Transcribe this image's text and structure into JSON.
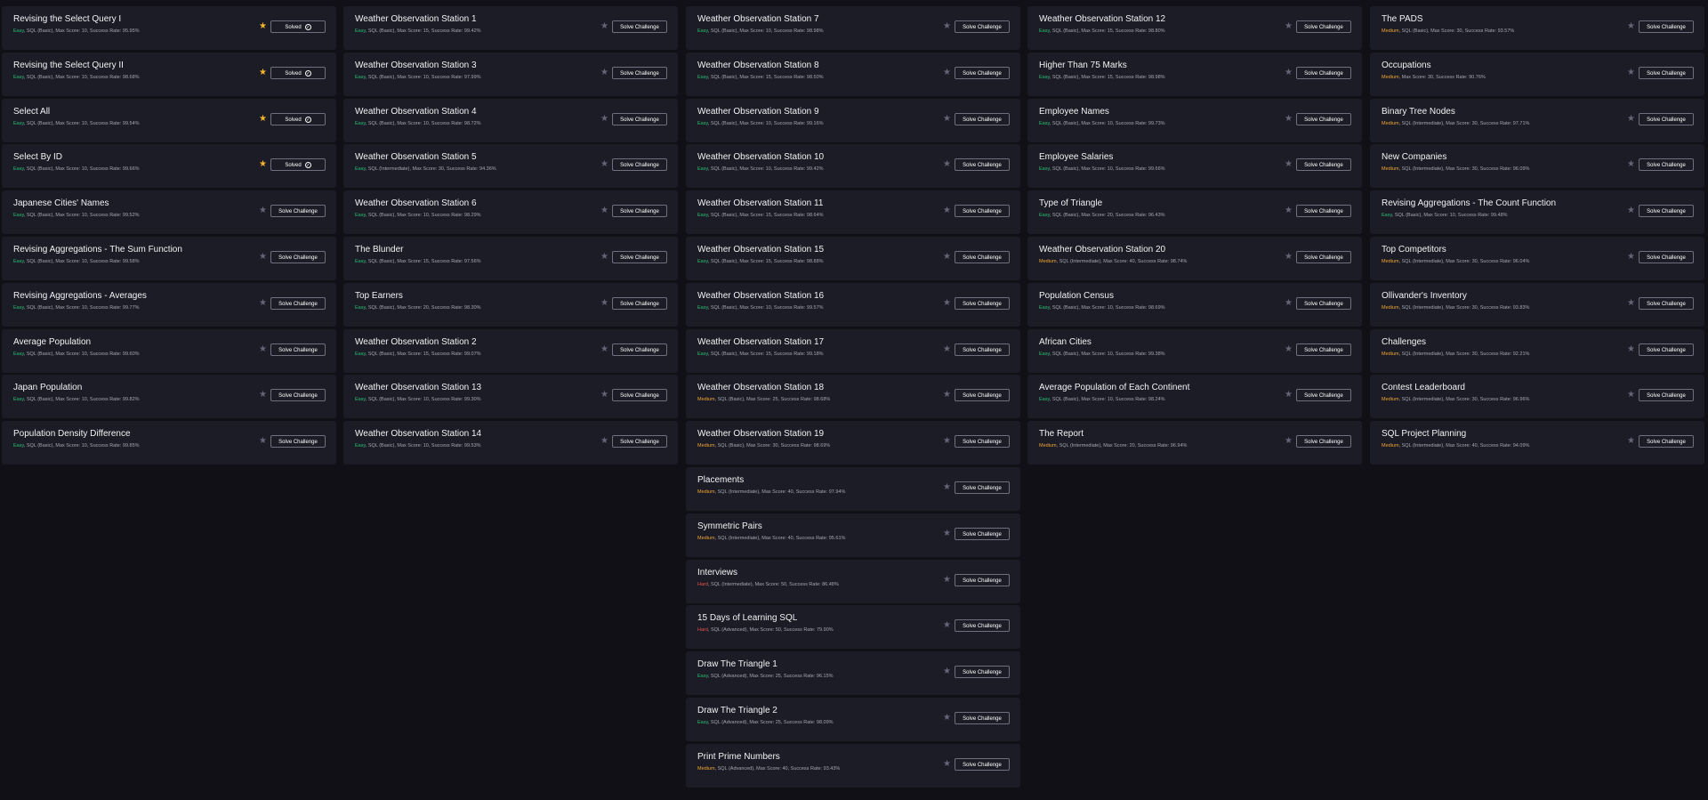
{
  "columns": [
    [
      {
        "title": "Revising the Select Query I",
        "difficulty": "Easy",
        "details": ", SQL (Basic), Max Score: 10, Success Rate: 95.95%",
        "starred": true,
        "button": "Solved",
        "solved": true
      },
      {
        "title": "Revising the Select Query II",
        "difficulty": "Easy",
        "details": ", SQL (Basic), Max Score: 10, Success Rate: 98.68%",
        "starred": true,
        "button": "Solved",
        "solved": true
      },
      {
        "title": "Select All",
        "difficulty": "Easy",
        "details": ", SQL (Basic), Max Score: 10, Success Rate: 99.54%",
        "starred": true,
        "button": "Solved",
        "solved": true
      },
      {
        "title": "Select By ID",
        "difficulty": "Easy",
        "details": ", SQL (Basic), Max Score: 10, Success Rate: 99.66%",
        "starred": true,
        "button": "Solved",
        "solved": true
      },
      {
        "title": "Japanese Cities' Names",
        "difficulty": "Easy",
        "details": ", SQL (Basic), Max Score: 10, Success Rate: 99.52%",
        "starred": false,
        "button": "Solve Challenge",
        "solved": false
      },
      {
        "title": "Revising Aggregations - The Sum Function",
        "difficulty": "Easy",
        "details": ", SQL (Basic), Max Score: 10, Success Rate: 99.58%",
        "starred": false,
        "button": "Solve Challenge",
        "solved": false
      },
      {
        "title": "Revising Aggregations - Averages",
        "difficulty": "Easy",
        "details": ", SQL (Basic), Max Score: 10, Success Rate: 99.77%",
        "starred": false,
        "button": "Solve Challenge",
        "solved": false
      },
      {
        "title": "Average Population",
        "difficulty": "Easy",
        "details": ", SQL (Basic), Max Score: 10, Success Rate: 99.60%",
        "starred": false,
        "button": "Solve Challenge",
        "solved": false
      },
      {
        "title": "Japan Population",
        "difficulty": "Easy",
        "details": ", SQL (Basic), Max Score: 10, Success Rate: 99.82%",
        "starred": false,
        "button": "Solve Challenge",
        "solved": false
      },
      {
        "title": "Population Density Difference",
        "difficulty": "Easy",
        "details": ", SQL (Basic), Max Score: 10, Success Rate: 99.85%",
        "starred": false,
        "button": "Solve Challenge",
        "solved": false
      }
    ],
    [
      {
        "title": "Weather Observation Station 1",
        "difficulty": "Easy",
        "details": ", SQL (Basic), Max Score: 15, Success Rate: 99.42%",
        "starred": false,
        "button": "Solve Challenge",
        "solved": false
      },
      {
        "title": "Weather Observation Station 3",
        "difficulty": "Easy",
        "details": ", SQL (Basic), Max Score: 10, Success Rate: 97.99%",
        "starred": false,
        "button": "Solve Challenge",
        "solved": false
      },
      {
        "title": "Weather Observation Station 4",
        "difficulty": "Easy",
        "details": ", SQL (Basic), Max Score: 10, Success Rate: 98.72%",
        "starred": false,
        "button": "Solve Challenge",
        "solved": false
      },
      {
        "title": "Weather Observation Station 5",
        "difficulty": "Easy",
        "details": ", SQL (Intermediate), Max Score: 30, Success Rate: 94.36%",
        "starred": false,
        "button": "Solve Challenge",
        "solved": false
      },
      {
        "title": "Weather Observation Station 6",
        "difficulty": "Easy",
        "details": ", SQL (Basic), Max Score: 10, Success Rate: 98.29%",
        "starred": false,
        "button": "Solve Challenge",
        "solved": false
      },
      {
        "title": "The Blunder",
        "difficulty": "Easy",
        "details": ", SQL (Basic), Max Score: 15, Success Rate: 97.56%",
        "starred": false,
        "button": "Solve Challenge",
        "solved": false
      },
      {
        "title": "Top Earners",
        "difficulty": "Easy",
        "details": ", SQL (Basic), Max Score: 20, Success Rate: 98.30%",
        "starred": false,
        "button": "Solve Challenge",
        "solved": false
      },
      {
        "title": "Weather Observation Station 2",
        "difficulty": "Easy",
        "details": ", SQL (Basic), Max Score: 15, Success Rate: 99.07%",
        "starred": false,
        "button": "Solve Challenge",
        "solved": false
      },
      {
        "title": "Weather Observation Station 13",
        "difficulty": "Easy",
        "details": ", SQL (Basic), Max Score: 10, Success Rate: 99.30%",
        "starred": false,
        "button": "Solve Challenge",
        "solved": false
      },
      {
        "title": "Weather Observation Station 14",
        "difficulty": "Easy",
        "details": ", SQL (Basic), Max Score: 10, Success Rate: 99.53%",
        "starred": false,
        "button": "Solve Challenge",
        "solved": false
      }
    ],
    [
      {
        "title": "Weather Observation Station 7",
        "difficulty": "Easy",
        "details": ", SQL (Basic), Max Score: 10, Success Rate: 98.98%",
        "starred": false,
        "button": "Solve Challenge",
        "solved": false
      },
      {
        "title": "Weather Observation Station 8",
        "difficulty": "Easy",
        "details": ", SQL (Basic), Max Score: 15, Success Rate: 98.50%",
        "starred": false,
        "button": "Solve Challenge",
        "solved": false
      },
      {
        "title": "Weather Observation Station 9",
        "difficulty": "Easy",
        "details": ", SQL (Basic), Max Score: 10, Success Rate: 99.16%",
        "starred": false,
        "button": "Solve Challenge",
        "solved": false
      },
      {
        "title": "Weather Observation Station 10",
        "difficulty": "Easy",
        "details": ", SQL (Basic), Max Score: 10, Success Rate: 99.42%",
        "starred": false,
        "button": "Solve Challenge",
        "solved": false
      },
      {
        "title": "Weather Observation Station 11",
        "difficulty": "Easy",
        "details": ", SQL (Basic), Max Score: 15, Success Rate: 98.64%",
        "starred": false,
        "button": "Solve Challenge",
        "solved": false
      },
      {
        "title": "Weather Observation Station 15",
        "difficulty": "Easy",
        "details": ", SQL (Basic), Max Score: 15, Success Rate: 98.88%",
        "starred": false,
        "button": "Solve Challenge",
        "solved": false
      },
      {
        "title": "Weather Observation Station 16",
        "difficulty": "Easy",
        "details": ", SQL (Basic), Max Score: 10, Success Rate: 99.57%",
        "starred": false,
        "button": "Solve Challenge",
        "solved": false
      },
      {
        "title": "Weather Observation Station 17",
        "difficulty": "Easy",
        "details": ", SQL (Basic), Max Score: 15, Success Rate: 99.18%",
        "starred": false,
        "button": "Solve Challenge",
        "solved": false
      },
      {
        "title": "Weather Observation Station 18",
        "difficulty": "Medium",
        "details": ", SQL (Basic), Max Score: 25, Success Rate: 98.68%",
        "starred": false,
        "button": "Solve Challenge",
        "solved": false
      },
      {
        "title": "Weather Observation Station 19",
        "difficulty": "Medium",
        "details": ", SQL (Basic), Max Score: 30, Success Rate: 98.69%",
        "starred": false,
        "button": "Solve Challenge",
        "solved": false
      },
      {
        "title": "Placements",
        "difficulty": "Medium",
        "details": ", SQL (Intermediate), Max Score: 40, Success Rate: 97.94%",
        "starred": false,
        "button": "Solve Challenge",
        "solved": false
      },
      {
        "title": "Symmetric Pairs",
        "difficulty": "Medium",
        "details": ", SQL (Intermediate), Max Score: 40, Success Rate: 95.61%",
        "starred": false,
        "button": "Solve Challenge",
        "solved": false
      },
      {
        "title": "Interviews",
        "difficulty": "Hard",
        "details": ", SQL (Intermediate), Max Score: 50, Success Rate: 86.48%",
        "starred": false,
        "button": "Solve Challenge",
        "solved": false
      },
      {
        "title": "15 Days of Learning SQL",
        "difficulty": "Hard",
        "details": ", SQL (Advanced), Max Score: 50, Success Rate: 79.90%",
        "starred": false,
        "button": "Solve Challenge",
        "solved": false
      },
      {
        "title": "Draw The Triangle 1",
        "difficulty": "Easy",
        "details": ", SQL (Advanced), Max Score: 25, Success Rate: 96.15%",
        "starred": false,
        "button": "Solve Challenge",
        "solved": false
      },
      {
        "title": "Draw The Triangle 2",
        "difficulty": "Easy",
        "details": ", SQL (Advanced), Max Score: 25, Success Rate: 98.09%",
        "starred": false,
        "button": "Solve Challenge",
        "solved": false
      },
      {
        "title": "Print Prime Numbers",
        "difficulty": "Medium",
        "details": ", SQL (Advanced), Max Score: 40, Success Rate: 93.43%",
        "starred": false,
        "button": "Solve Challenge",
        "solved": false
      }
    ],
    [
      {
        "title": "Weather Observation Station 12",
        "difficulty": "Easy",
        "details": ", SQL (Basic), Max Score: 15, Success Rate: 98.80%",
        "starred": false,
        "button": "Solve Challenge",
        "solved": false
      },
      {
        "title": "Higher Than 75 Marks",
        "difficulty": "Easy",
        "details": ", SQL (Basic), Max Score: 15, Success Rate: 98.98%",
        "starred": false,
        "button": "Solve Challenge",
        "solved": false
      },
      {
        "title": "Employee Names",
        "difficulty": "Easy",
        "details": ", SQL (Basic), Max Score: 10, Success Rate: 99.73%",
        "starred": false,
        "button": "Solve Challenge",
        "solved": false
      },
      {
        "title": "Employee Salaries",
        "difficulty": "Easy",
        "details": ", SQL (Basic), Max Score: 10, Success Rate: 99.66%",
        "starred": false,
        "button": "Solve Challenge",
        "solved": false
      },
      {
        "title": "Type of Triangle",
        "difficulty": "Easy",
        "details": ", SQL (Basic), Max Score: 20, Success Rate: 96.43%",
        "starred": false,
        "button": "Solve Challenge",
        "solved": false
      },
      {
        "title": "Weather Observation Station 20",
        "difficulty": "Medium",
        "details": ", SQL (Intermediate), Max Score: 40, Success Rate: 98.74%",
        "starred": false,
        "button": "Solve Challenge",
        "solved": false
      },
      {
        "title": "Population Census",
        "difficulty": "Easy",
        "details": ", SQL (Basic), Max Score: 10, Success Rate: 98.69%",
        "starred": false,
        "button": "Solve Challenge",
        "solved": false
      },
      {
        "title": "African Cities",
        "difficulty": "Easy",
        "details": ", SQL (Basic), Max Score: 10, Success Rate: 99.38%",
        "starred": false,
        "button": "Solve Challenge",
        "solved": false
      },
      {
        "title": "Average Population of Each Continent",
        "difficulty": "Easy",
        "details": ", SQL (Basic), Max Score: 10, Success Rate: 98.24%",
        "starred": false,
        "button": "Solve Challenge",
        "solved": false
      },
      {
        "title": "The Report",
        "difficulty": "Medium",
        "details": ", SQL (Intermediate), Max Score: 20, Success Rate: 96.94%",
        "starred": false,
        "button": "Solve Challenge",
        "solved": false
      }
    ],
    [
      {
        "title": "The PADS",
        "difficulty": "Medium",
        "details": ", SQL (Basic), Max Score: 30, Success Rate: 93.57%",
        "starred": false,
        "button": "Solve Challenge",
        "solved": false
      },
      {
        "title": "Occupations",
        "difficulty": "Medium",
        "details": ", Max Score: 30, Success Rate: 90.76%",
        "starred": false,
        "button": "Solve Challenge",
        "solved": false
      },
      {
        "title": "Binary Tree Nodes",
        "difficulty": "Medium",
        "details": ", SQL (Intermediate), Max Score: 30, Success Rate: 97.71%",
        "starred": false,
        "button": "Solve Challenge",
        "solved": false
      },
      {
        "title": "New Companies",
        "difficulty": "Medium",
        "details": ", SQL (Intermediate), Max Score: 30, Success Rate: 96.09%",
        "starred": false,
        "button": "Solve Challenge",
        "solved": false
      },
      {
        "title": "Revising Aggregations - The Count Function",
        "difficulty": "Easy",
        "details": ", SQL (Basic), Max Score: 10, Success Rate: 99.48%",
        "starred": false,
        "button": "Solve Challenge",
        "solved": false
      },
      {
        "title": "Top Competitors",
        "difficulty": "Medium",
        "details": ", SQL (Intermediate), Max Score: 30, Success Rate: 96.04%",
        "starred": false,
        "button": "Solve Challenge",
        "solved": false
      },
      {
        "title": "Ollivander's Inventory",
        "difficulty": "Medium",
        "details": ", SQL (Intermediate), Max Score: 30, Success Rate: 93.83%",
        "starred": false,
        "button": "Solve Challenge",
        "solved": false
      },
      {
        "title": "Challenges",
        "difficulty": "Medium",
        "details": ", SQL (Intermediate), Max Score: 30, Success Rate: 92.21%",
        "starred": false,
        "button": "Solve Challenge",
        "solved": false
      },
      {
        "title": "Contest Leaderboard",
        "difficulty": "Medium",
        "details": ", SQL (Intermediate), Max Score: 30, Success Rate: 96.96%",
        "starred": false,
        "button": "Solve Challenge",
        "solved": false
      },
      {
        "title": "SQL Project Planning",
        "difficulty": "Medium",
        "details": ", SQL (Intermediate), Max Score: 40, Success Rate: 94.09%",
        "starred": false,
        "button": "Solve Challenge",
        "solved": false
      }
    ]
  ],
  "icons": {
    "star": "star-icon",
    "solved": "check-circle-icon"
  },
  "colors": {
    "background": "#101016",
    "card": "#1c1c26",
    "easy": "#2bbf74",
    "medium": "#f0a532",
    "hard": "#e4524c",
    "star_active": "#f5b42a",
    "star_inactive": "#65657a"
  }
}
